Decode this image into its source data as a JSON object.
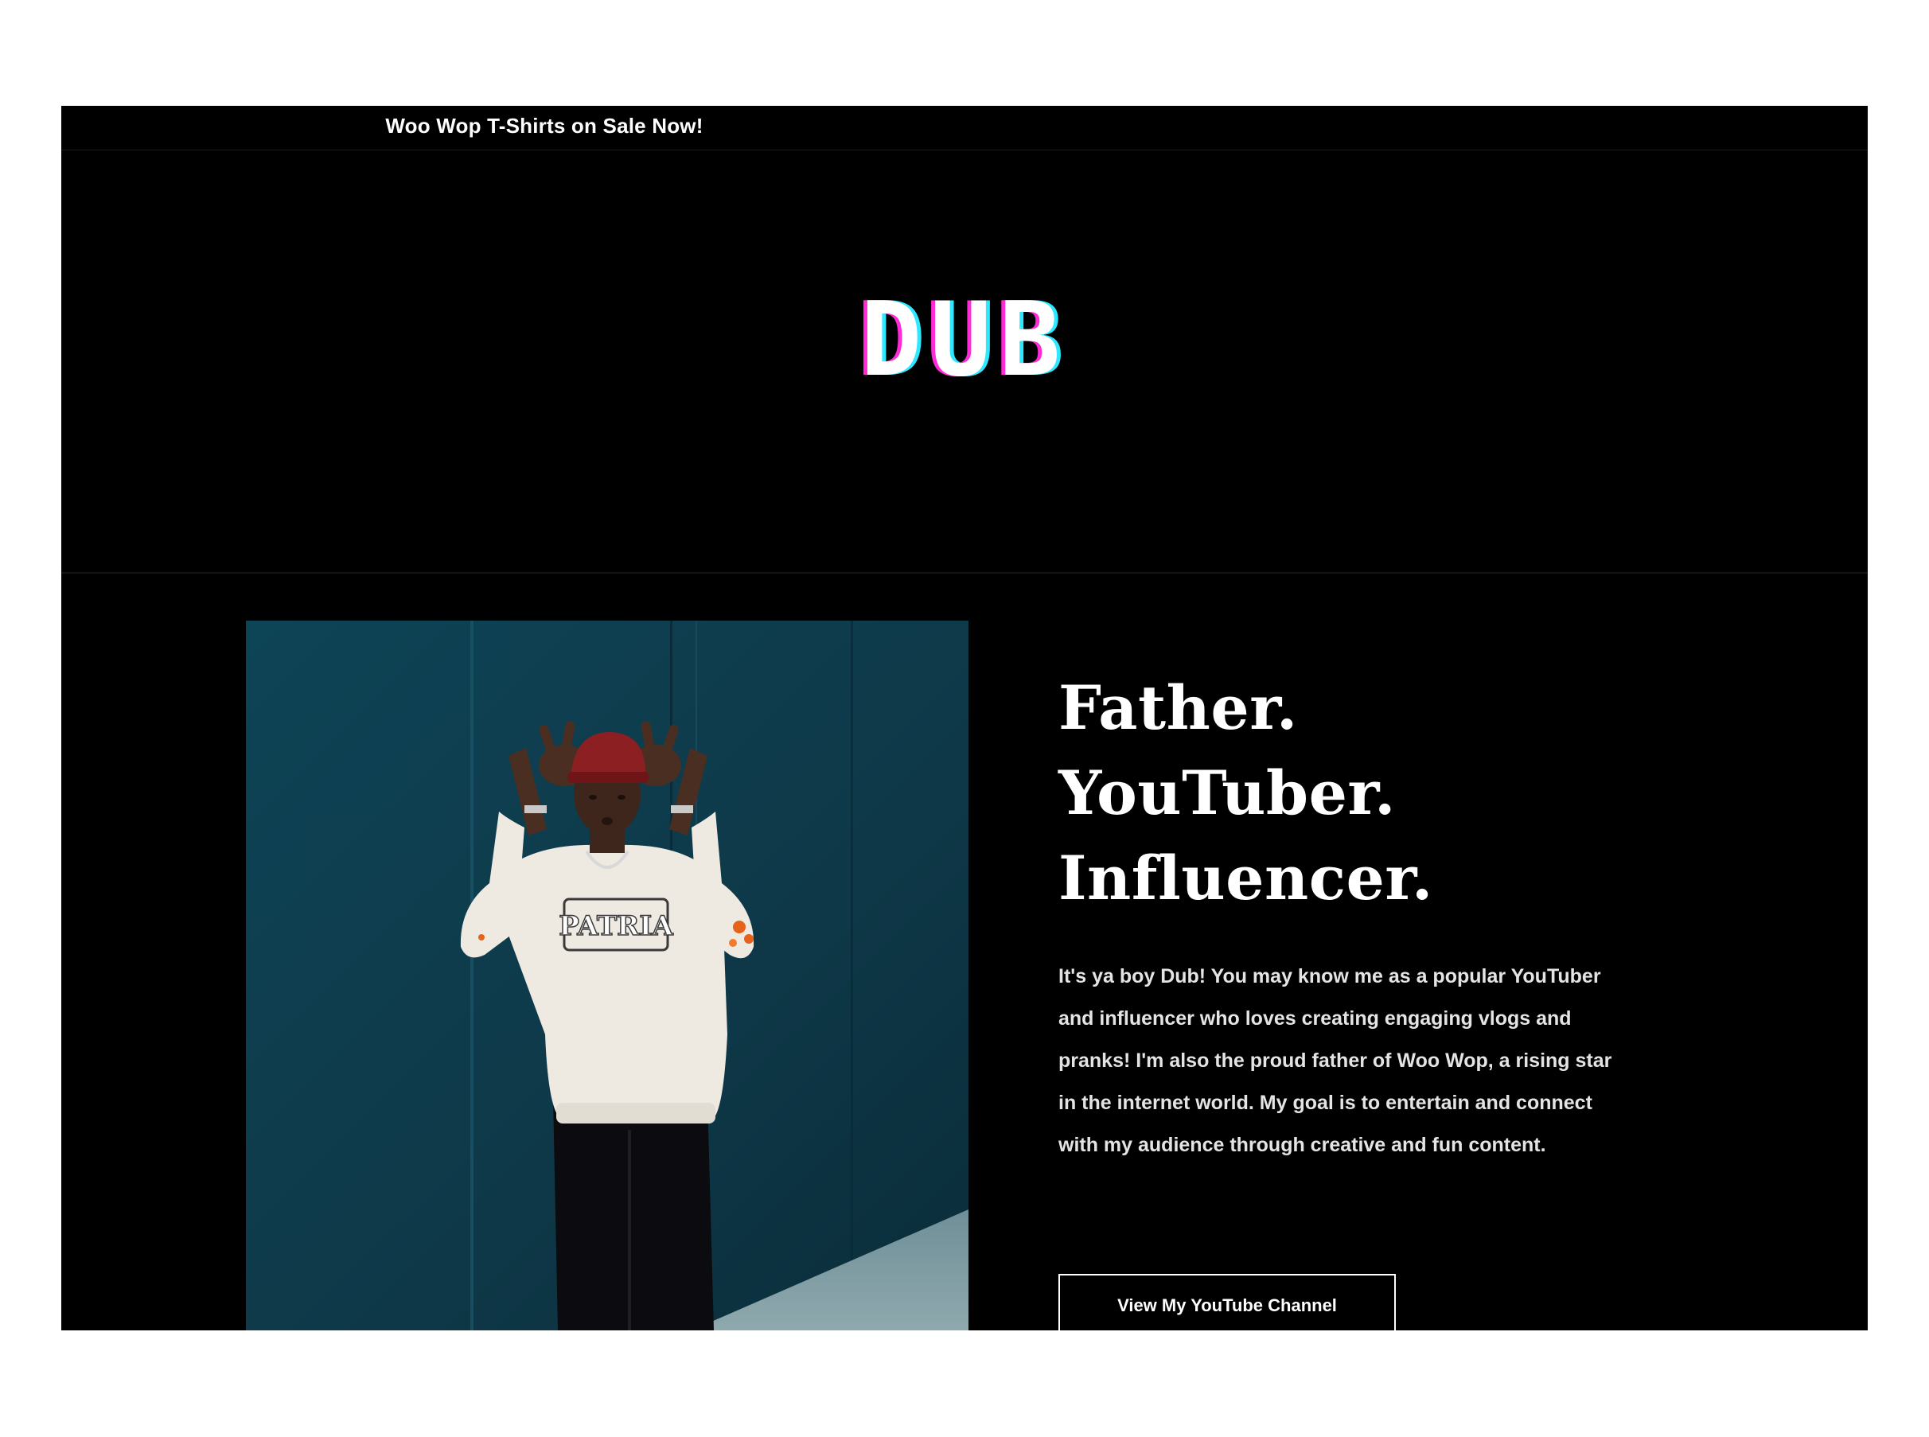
{
  "announcement": {
    "text": "Woo Wop T-Shirts on Sale Now!"
  },
  "header": {
    "logo_text": "DUB"
  },
  "hero": {
    "headline": [
      "Father.",
      "YouTuber.",
      "Influencer."
    ],
    "bio": "It's ya boy Dub! You may know me as a popular YouTuber and influencer who loves creating engaging vlogs and pranks! I'm also the proud father of Woo Wop, a rising star in the internet world. My goal is to entertain and connect with my audience through creative and fun content.",
    "cta_label": "View My YouTube Channel",
    "photo_shirt_text": "PATRIA"
  },
  "colors": {
    "page_background": "#000000",
    "text": "#ffffff",
    "logo_glow_left": "#ff2bd6",
    "logo_glow_right": "#2ee8ff",
    "photo_wall": "#0f3a49"
  }
}
